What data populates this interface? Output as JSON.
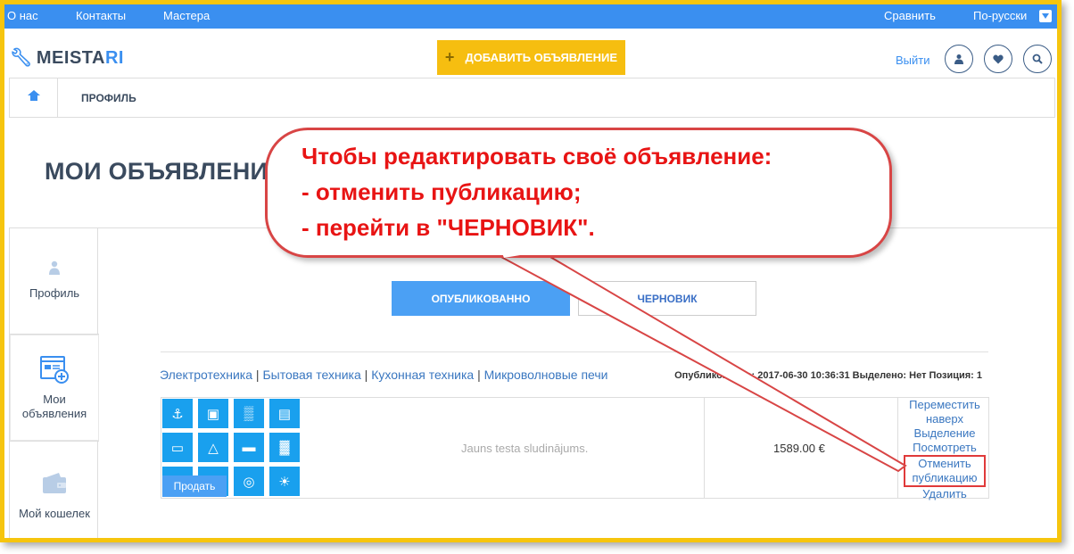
{
  "topbar": {
    "about": "О нас",
    "contacts": "Контакты",
    "masters": "Мастера",
    "compare": "Сравнить",
    "language": "По-русски"
  },
  "header": {
    "logo_text_main": "MEISTA",
    "logo_text_accent": "RI",
    "add_button": "ДОБАВИТЬ ОБЪЯВЛЕНИЕ",
    "logout": "Выйти",
    "icons": [
      "user-icon",
      "heart-icon",
      "search-icon"
    ]
  },
  "breadcrumb": {
    "current": "ПРОФИЛЬ"
  },
  "page_title": "МОИ ОБЪЯВЛЕНИЯ",
  "sidebar": {
    "items": [
      {
        "label": "Профиль",
        "icon": "user-icon"
      },
      {
        "label": "Мои объявления",
        "icon": "ads-icon"
      },
      {
        "label": "Мой кошелек",
        "icon": "wallet-icon"
      }
    ]
  },
  "tabs": {
    "published": "ОПУБЛИКОВАННО",
    "draft": "ЧЕРНОВИК"
  },
  "listing": {
    "categories": [
      "Электротехника",
      "Бытовая техника",
      "Кухонная техника",
      "Микроволновые печи"
    ],
    "meta": "Опубликованно: 2017-06-30 10:36:31 Выделено: Нет Позиция: 1",
    "sell_badge": "Продать",
    "title": "Jauns testa sludinājums.",
    "price": "1589.00 €",
    "actions": {
      "move_up": "Переместить наверх",
      "highlight": "Выделение",
      "view": "Посмотреть",
      "unpublish": "Отменить публикацию",
      "delete": "Удалить"
    }
  },
  "callout": {
    "line1": "Чтобы редактировать своё объявление:",
    "line2": "- отменить публикацию;",
    "line3": "- перейти в \"ЧЕРНОВИК\"."
  },
  "colors": {
    "topbar": "#3a8ff0",
    "accent_yellow": "#f6be10",
    "callout_red": "#e81414",
    "tile_blue": "#19a0ee"
  }
}
